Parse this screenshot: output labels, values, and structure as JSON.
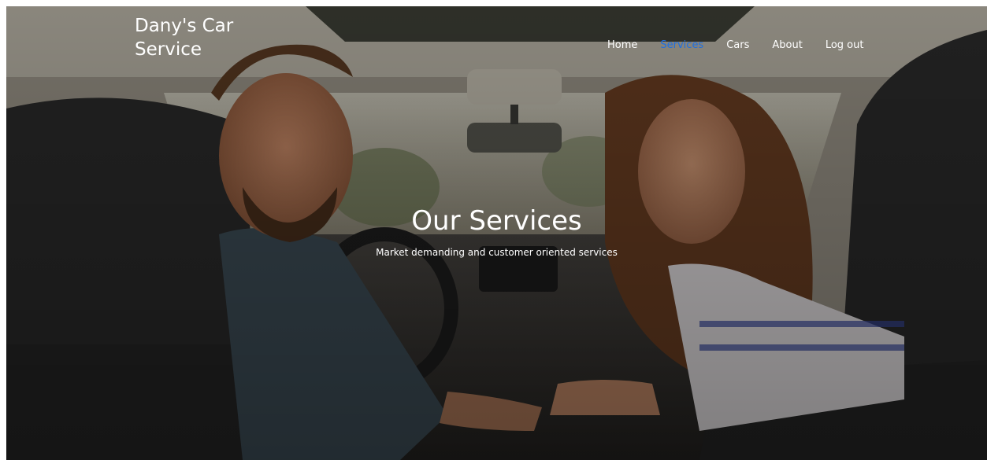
{
  "site": {
    "brand_line1": "Dany's Car",
    "brand_line2": "Service"
  },
  "nav": {
    "items": [
      {
        "label": "Home",
        "active": false
      },
      {
        "label": "Services",
        "active": true
      },
      {
        "label": "Cars",
        "active": false
      },
      {
        "label": "About",
        "active": false
      },
      {
        "label": "Log out",
        "active": false
      }
    ]
  },
  "hero": {
    "title": "Our Services",
    "subtitle": "Market demanding and customer oriented services",
    "image_description_icon": "car-interior-photo"
  },
  "colors": {
    "nav_active": "#1f6fe0",
    "text": "#ffffff"
  }
}
